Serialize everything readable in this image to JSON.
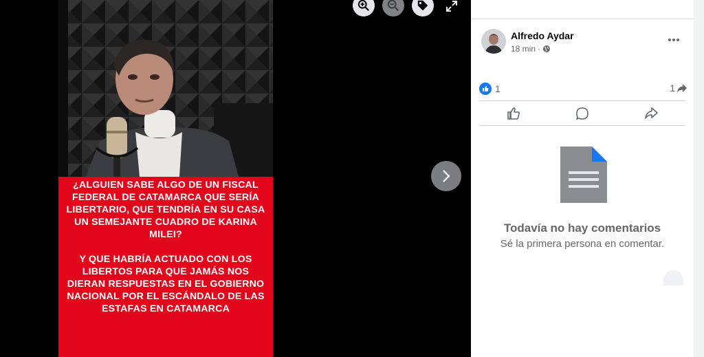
{
  "viewer": {
    "caption_paragraph_1": "¿ALGUIEN SABE ALGO DE UN FISCAL FEDERAL DE CATAMARCA QUE SERÍA LIBERTARIO, QUE TENDRÍA EN SU CASA UN SEMEJANTE CUADRO DE KARINA MILEI?",
    "caption_paragraph_2": "Y QUE HABRÍA ACTUADO CON LOS LIBERTOS PARA QUE JAMÁS NOS DIERAN RESPUESTAS EN EL GOBIERNO NACIONAL POR EL ESCÁNDALO DE LAS ESTAFAS EN CATAMARCA",
    "toolbar": {
      "zoom_in_icon": "zoom-in-icon",
      "zoom_out_icon": "zoom-out-icon",
      "tag_icon": "tag-icon",
      "fullscreen_icon": "fullscreen-icon"
    },
    "next_icon": "chevron-right-icon"
  },
  "post": {
    "author": "Alfredo Aydar",
    "time": "18 min",
    "separator": "·",
    "privacy_icon": "globe-icon",
    "reaction_count": "1",
    "share_count": "1"
  },
  "comments": {
    "empty_title": "Todavía no hay comentarios",
    "empty_subtitle": "Sé la primera persona en comentar."
  },
  "colors": {
    "caption_bg": "#e3051b",
    "facebook_blue": "#1877f2",
    "sidebar_bg": "#ffffff",
    "muted_text": "#65676b"
  }
}
